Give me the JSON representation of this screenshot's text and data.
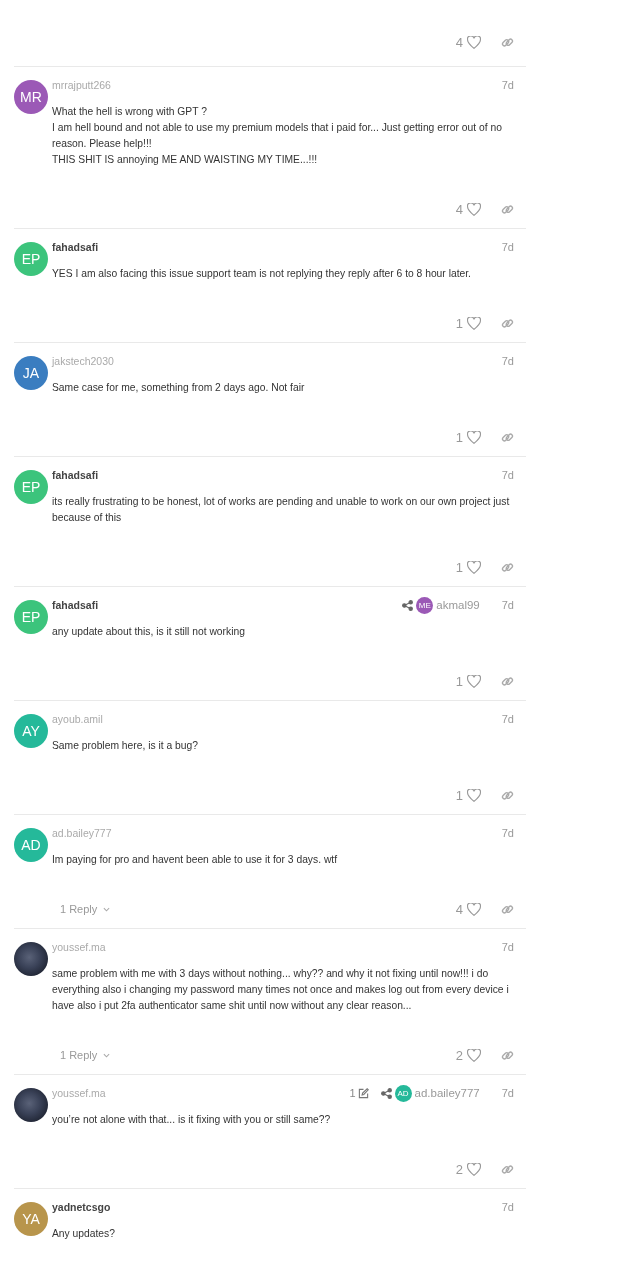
{
  "partial_post": {
    "likes": "4"
  },
  "posts": [
    {
      "avatar": {
        "kind": "initials",
        "initials": "MR",
        "color": "#9b59b6"
      },
      "username": "mrrajputt266",
      "username_bold": false,
      "age": "7d",
      "body": [
        "What the hell is wrong with GPT ?",
        "I am hell bound and not able to use my premium models that i paid for... Just getting error out of no reason. Please help!!!",
        "THIS SHIT IS annoying ME AND WAISTING MY TIME...!!!"
      ],
      "likes": "4"
    },
    {
      "avatar": {
        "kind": "initials",
        "initials": "EP",
        "color": "#3cc47c"
      },
      "username": "fahadsafi",
      "username_bold": true,
      "age": "7d",
      "body": [
        "YES I am also facing this issue support team is not replying they reply after 6 to 8 hour later."
      ],
      "likes": "1"
    },
    {
      "avatar": {
        "kind": "initials",
        "initials": "JA",
        "color": "#3a7dc0"
      },
      "username": "jakstech2030",
      "username_bold": false,
      "age": "7d",
      "body": [
        "Same case for me, something from 2 days ago. Not fair"
      ],
      "likes": "1"
    },
    {
      "avatar": {
        "kind": "initials",
        "initials": "EP",
        "color": "#3cc47c"
      },
      "username": "fahadsafi",
      "username_bold": true,
      "age": "7d",
      "body": [
        "its really frustrating to be honest, lot of works are pending and unable to work on our own project just because of this"
      ],
      "likes": "1"
    },
    {
      "avatar": {
        "kind": "initials",
        "initials": "EP",
        "color": "#3cc47c"
      },
      "username": "fahadsafi",
      "username_bold": true,
      "age": "7d",
      "reply_to": {
        "initials": "ME",
        "color": "#9b59b6",
        "username": "akmal99"
      },
      "body": [
        "any update about this, is it still not working"
      ],
      "likes": "1"
    },
    {
      "avatar": {
        "kind": "initials",
        "initials": "AY",
        "color": "#25b99a"
      },
      "username": "ayoub.amil",
      "username_bold": false,
      "age": "7d",
      "body": [
        "Same problem here, is it a bug?"
      ],
      "likes": "1"
    },
    {
      "avatar": {
        "kind": "initials",
        "initials": "AD",
        "color": "#25b99a"
      },
      "username": "ad.bailey777",
      "username_bold": false,
      "age": "7d",
      "body": [
        "Im paying for pro and havent been able to use it for 3 days. wtf"
      ],
      "replies": "1 Reply",
      "likes": "4"
    },
    {
      "avatar": {
        "kind": "photo"
      },
      "username": "youssef.ma",
      "username_bold": false,
      "age": "7d",
      "body": [
        "same problem with me with 3 days without nothing... why?? and why it not fixing until now!!! i do everything also i changing my password many times not once and makes log out from every device i have also i put 2fa authenticator same shit until now without any clear reason..."
      ],
      "replies": "1 Reply",
      "likes": "2"
    },
    {
      "avatar": {
        "kind": "photo"
      },
      "username": "youssef.ma",
      "username_bold": false,
      "age": "7d",
      "edits": "1",
      "reply_to": {
        "initials": "AD",
        "color": "#25b99a",
        "username": "ad.bailey777"
      },
      "body": [
        "you’re not alone with that... is it fixing with you or still same??"
      ],
      "likes": "2"
    },
    {
      "avatar": {
        "kind": "initials",
        "initials": "YA",
        "color": "#b8954c"
      },
      "username": "yadnetcsgo",
      "username_bold": true,
      "age": "7d",
      "body": [
        "Any updates?"
      ]
    }
  ]
}
